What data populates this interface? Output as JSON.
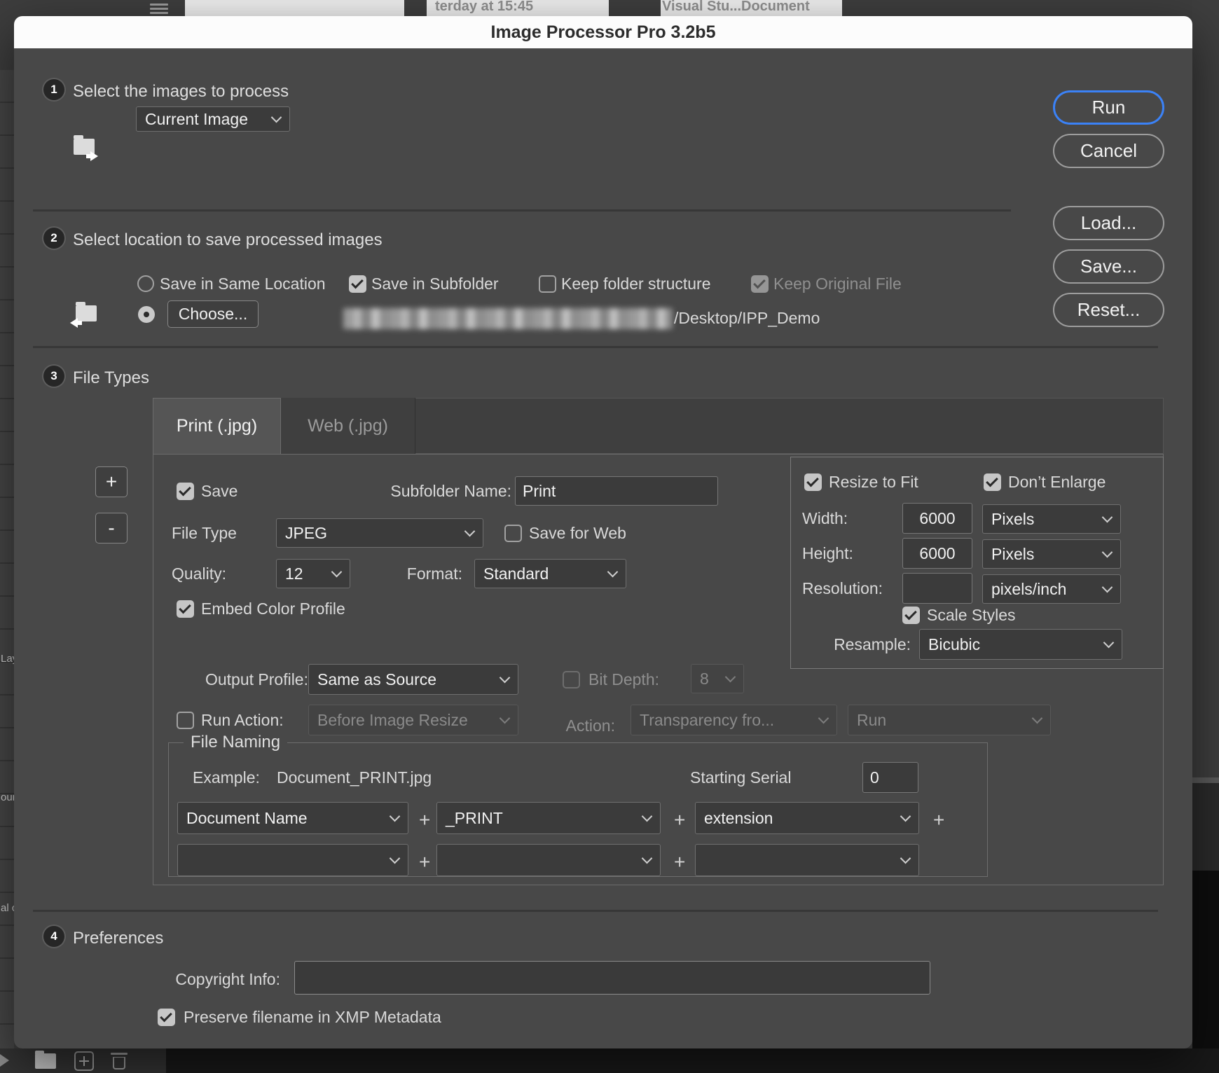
{
  "background": {
    "top_fragments": {
      "time_text": "terday at 15:45",
      "doc_text": "Visual Stu...Document"
    },
    "left_panel_fragments": [
      "Lay",
      "our",
      "al c"
    ],
    "icons": [
      "hamburger-icon",
      "play-icon",
      "folder-icon",
      "add-icon",
      "trash-icon"
    ]
  },
  "dialog": {
    "title": "Image Processor Pro 3.2b5",
    "buttons": {
      "run": "Run",
      "cancel": "Cancel",
      "load": "Load...",
      "save": "Save...",
      "reset": "Reset..."
    },
    "section1": {
      "number": "1",
      "title": "Select the images to process",
      "source_value": "Current Image"
    },
    "section2": {
      "number": "2",
      "title": "Select location to save processed images",
      "save_same_location": "Save in Same Location",
      "save_in_subfolder": "Save in Subfolder",
      "keep_folder_structure": "Keep folder structure",
      "keep_original_file": "Keep Original File",
      "choose_button": "Choose...",
      "path_visible": "/Desktop/IPP_Demo"
    },
    "section3": {
      "number": "3",
      "title": "File Types",
      "tabs": [
        "Print (.jpg)",
        "Web (.jpg)"
      ],
      "add_tab": "+",
      "remove_tab": "-",
      "save_label": "Save",
      "subfolder_name_label": "Subfolder Name:",
      "subfolder_name_value": "Print",
      "file_type_label": "File Type",
      "file_type_value": "JPEG",
      "save_for_web": "Save for Web",
      "quality_label": "Quality:",
      "quality_value": "12",
      "format_label": "Format:",
      "format_value": "Standard",
      "embed_color_profile": "Embed Color Profile",
      "output_profile_label": "Output Profile:",
      "output_profile_value": "Same as Source",
      "bit_depth_label": "Bit Depth:",
      "bit_depth_value": "8",
      "run_action_label": "Run Action:",
      "run_action_when_value": "Before Image Resize",
      "action_label": "Action:",
      "action_value": "Transparency fro...",
      "action_run_value": "Run",
      "resize": {
        "resize_to_fit": "Resize to Fit",
        "dont_enlarge": "Don’t Enlarge",
        "width_label": "Width:",
        "width_value": "6000",
        "height_label": "Height:",
        "height_value": "6000",
        "unit_pixels": "Pixels",
        "resolution_label": "Resolution:",
        "resolution_value": "",
        "unit_resolution": "pixels/inch",
        "scale_styles": "Scale Styles",
        "resample_label": "Resample:",
        "resample_value": "Bicubic"
      },
      "file_naming": {
        "legend": "File Naming",
        "example_label": "Example:",
        "example_value": "Document_PRINT.jpg",
        "starting_serial_label": "Starting Serial",
        "starting_serial_value": "0",
        "plus_sign": "+",
        "row1": [
          "Document Name",
          "_PRINT",
          "extension"
        ],
        "row2": [
          "",
          "",
          ""
        ]
      }
    },
    "section4": {
      "number": "4",
      "title": "Preferences",
      "copyright_label": "Copyright Info:",
      "copyright_value": "",
      "preserve_filename": "Preserve filename in XMP Metadata"
    }
  },
  "colors": {
    "accent_blue": "#3b82f7",
    "dialog_bg": "#484848",
    "titlebar_bg": "#fcfcfc"
  }
}
